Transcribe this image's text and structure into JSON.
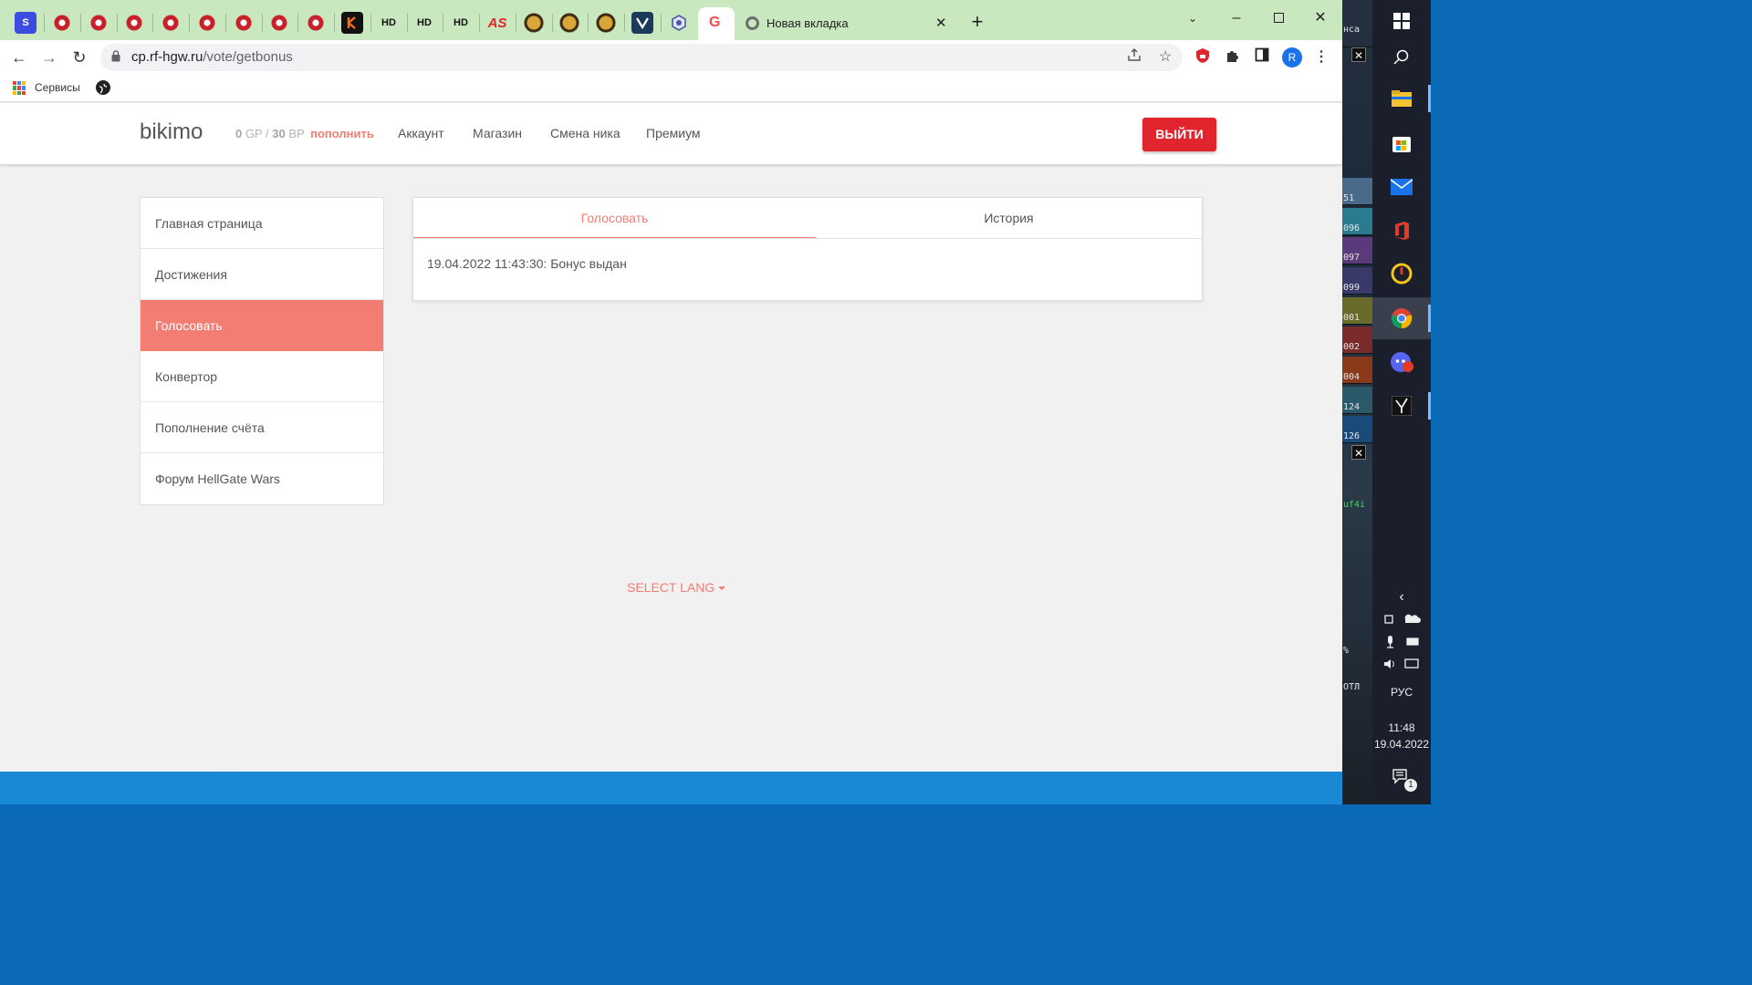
{
  "browser": {
    "tabs": {
      "pinned_labels": [
        "S",
        "HD",
        "HD",
        "HD",
        "AS"
      ],
      "active_tab_glyph": "G",
      "newtab_title": "Новая вкладка"
    },
    "toolbar": {
      "url_host": "cp.rf-hgw.ru",
      "url_path": "/vote/getbonus",
      "profile_initial": "R"
    },
    "bookmarks": {
      "services_label": "Сервисы"
    }
  },
  "site": {
    "brand": "bikimo",
    "balance": {
      "gp_value": "0",
      "gp_unit": "GP /",
      "bp_value": "30",
      "bp_unit": "BP",
      "topup_label": "пополнить"
    },
    "topnav": [
      "Аккаунт",
      "Магазин",
      "Смена ника",
      "Премиум"
    ],
    "logout_label": "ВЫЙТИ",
    "sidemenu": [
      "Главная страница",
      "Достижения",
      "Голосовать",
      "Конвертор",
      "Пополнение счёта",
      "Форум HellGate Wars"
    ],
    "sidemenu_active_index": 2,
    "panel": {
      "tabs": [
        "Голосовать",
        "История"
      ],
      "log": "19.04.2022 11:43:30: Бонус выдан"
    },
    "select_lang": "SELECT LANG"
  },
  "game_strip": {
    "numbers": [
      "нса",
      "51",
      "096",
      "097",
      "099",
      "001",
      "002",
      "004",
      "124",
      "126",
      "uf4i",
      "%",
      "ОТЛ"
    ]
  },
  "taskbar": {
    "language": "РУС",
    "time": "11:48",
    "date": "19.04.2022",
    "notification_count": "1"
  },
  "colors": {
    "accent": "#f37d72",
    "logout": "#e0252e",
    "tabbar": "#c9e8c0",
    "taskbar": "#1b1f2c"
  }
}
